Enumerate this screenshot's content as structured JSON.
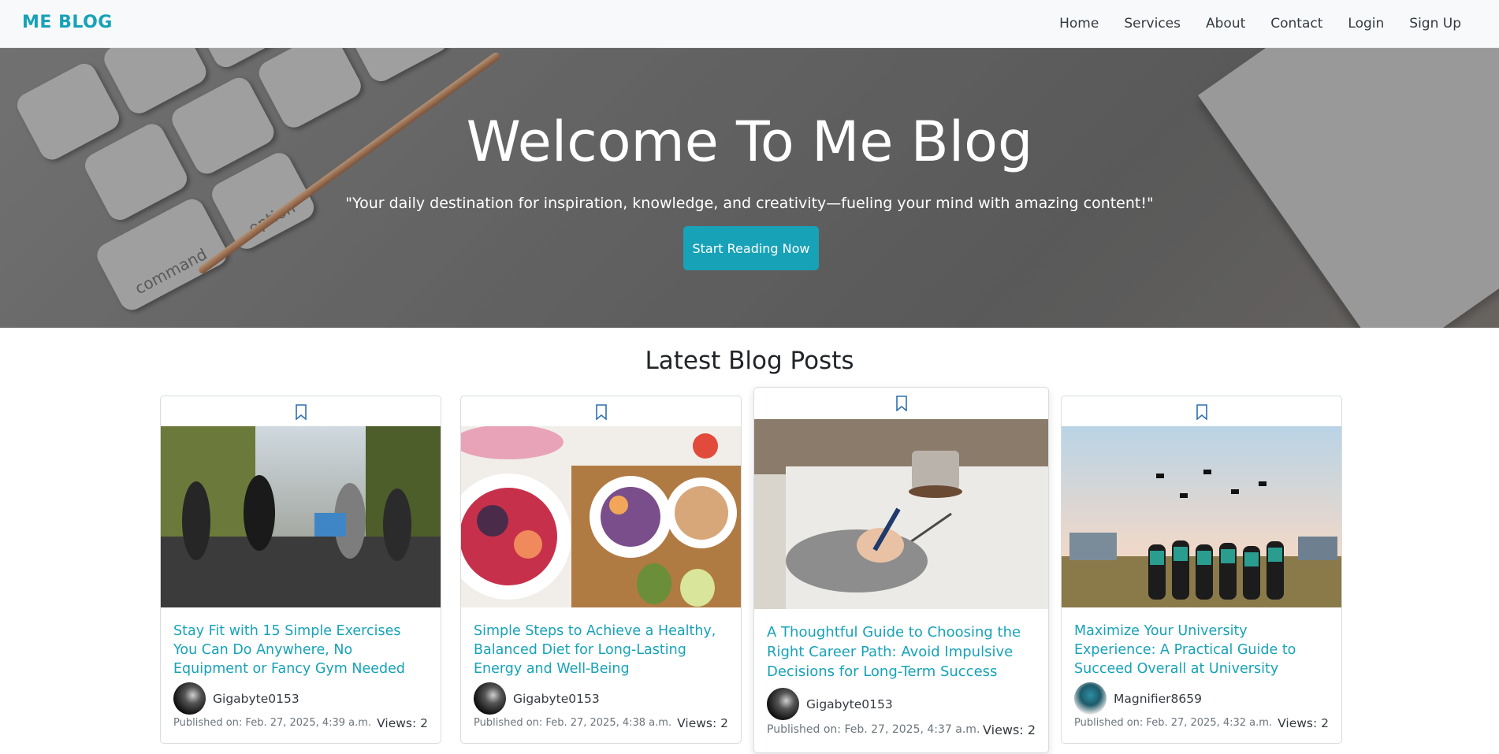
{
  "navbar": {
    "brand": "ME BLOG",
    "links": [
      "Home",
      "Services",
      "About",
      "Contact",
      "Login",
      "Sign Up"
    ]
  },
  "hero": {
    "title": "Welcome To Me Blog",
    "subtitle": "\"Your daily destination for inspiration, knowledge, and creativity—fueling your mind with amazing content!\"",
    "button_label": "Start Reading Now",
    "key_labels": [
      "command",
      "option"
    ]
  },
  "section": {
    "title": "Latest Blog Posts"
  },
  "posts": [
    {
      "title": "Stay Fit with 15 Simple Exercises You Can Do Anywhere, No Equipment or Fancy Gym Needed",
      "author": "Gigabyte0153",
      "published": "Published on: Feb. 27, 2025, 4:39 a.m.",
      "views": "Views: 2",
      "image": "runners-on-street"
    },
    {
      "title": "Simple Steps to Achieve a Healthy, Balanced Diet for Long-Lasting Energy and Well-Being",
      "author": "Gigabyte0153",
      "published": "Published on: Feb. 27, 2025, 4:38 a.m.",
      "views": "Views: 2",
      "image": "healthy-food-bowls"
    },
    {
      "title": "A Thoughtful Guide to Choosing the Right Career Path: Avoid Impulsive Decisions for Long-Term Success",
      "author": "Gigabyte0153",
      "published": "Published on: Feb. 27, 2025, 4:37 a.m.",
      "views": "Views: 2",
      "image": "hand-writing-notebook"
    },
    {
      "title": "Maximize Your University Experience: A Practical Guide to Succeed Overall at University",
      "author": "Magnifier8659",
      "published": "Published on: Feb. 27, 2025, 4:32 a.m.",
      "views": "Views: 2",
      "image": "graduates-throwing-caps"
    }
  ],
  "colors": {
    "accent": "#17a2b8",
    "navbar_bg": "#f8f9fa",
    "text": "#212529",
    "muted": "#6c757d"
  },
  "icons": {
    "bookmark": "bookmark-icon"
  }
}
